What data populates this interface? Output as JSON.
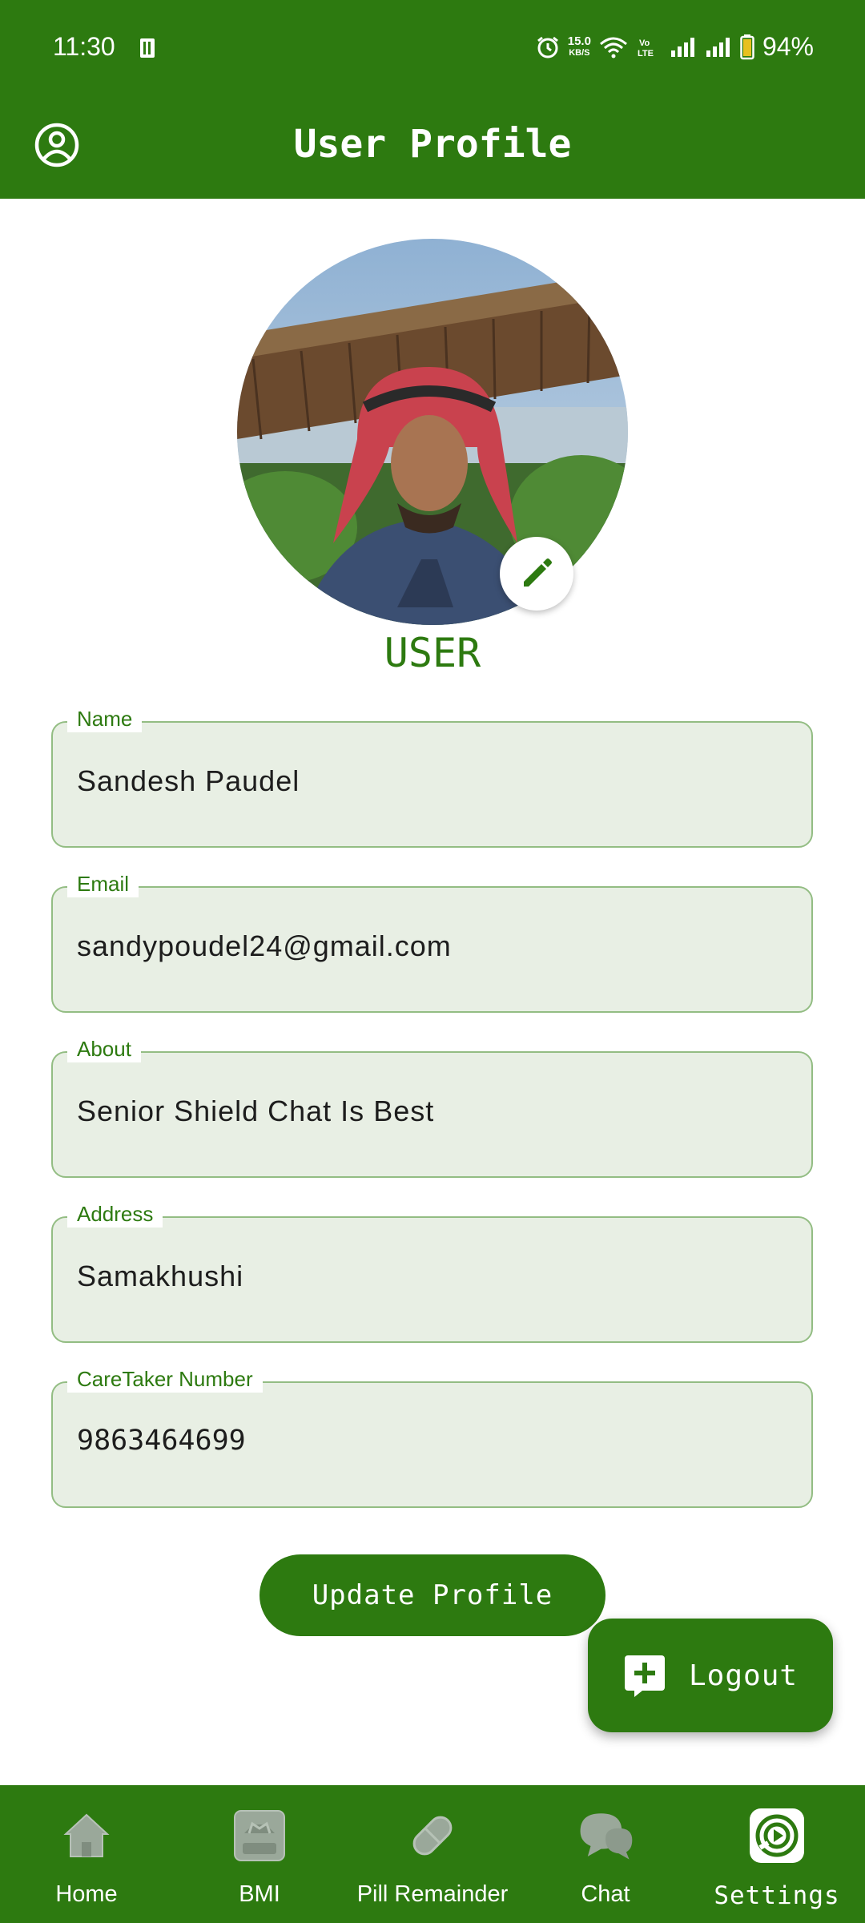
{
  "status_bar": {
    "time": "11:30",
    "net_speed_value": "15.0",
    "net_speed_unit": "KB/S",
    "battery": "94%",
    "icons": [
      "notification-icon",
      "alarm-icon",
      "wifi-icon",
      "volte-icon",
      "signal-icon",
      "signal-icon",
      "battery-icon"
    ]
  },
  "app_bar": {
    "title": "User Profile",
    "icon": "account-circle-icon"
  },
  "profile": {
    "name_heading": "USER",
    "edit_icon": "pencil-icon"
  },
  "form": {
    "fields": [
      {
        "label": "Name",
        "value": "Sandesh Paudel"
      },
      {
        "label": "Email",
        "value": "sandypoudel24@gmail.com"
      },
      {
        "label": "About",
        "value": "Senior Shield Chat Is Best"
      },
      {
        "label": "Address",
        "value": "Samakhushi"
      },
      {
        "label": "CareTaker Number",
        "value": "9863464699"
      }
    ]
  },
  "actions": {
    "update_label": "Update Profile",
    "logout_label": "Logout",
    "logout_icon": "add-box-icon"
  },
  "bottom_nav": {
    "items": [
      {
        "label": "Home",
        "icon": "home-icon"
      },
      {
        "label": "BMI",
        "icon": "scale-icon"
      },
      {
        "label": "Pill Remainder",
        "icon": "pill-icon"
      },
      {
        "label": "Chat",
        "icon": "chat-icon"
      },
      {
        "label": "Settings",
        "icon": "settings-icon"
      }
    ],
    "active": "Settings"
  },
  "colors": {
    "primary": "#2d7a10",
    "field_fill": "#e8efe4",
    "field_border": "#93bd83",
    "inactive_icon": "#9aa89a"
  }
}
